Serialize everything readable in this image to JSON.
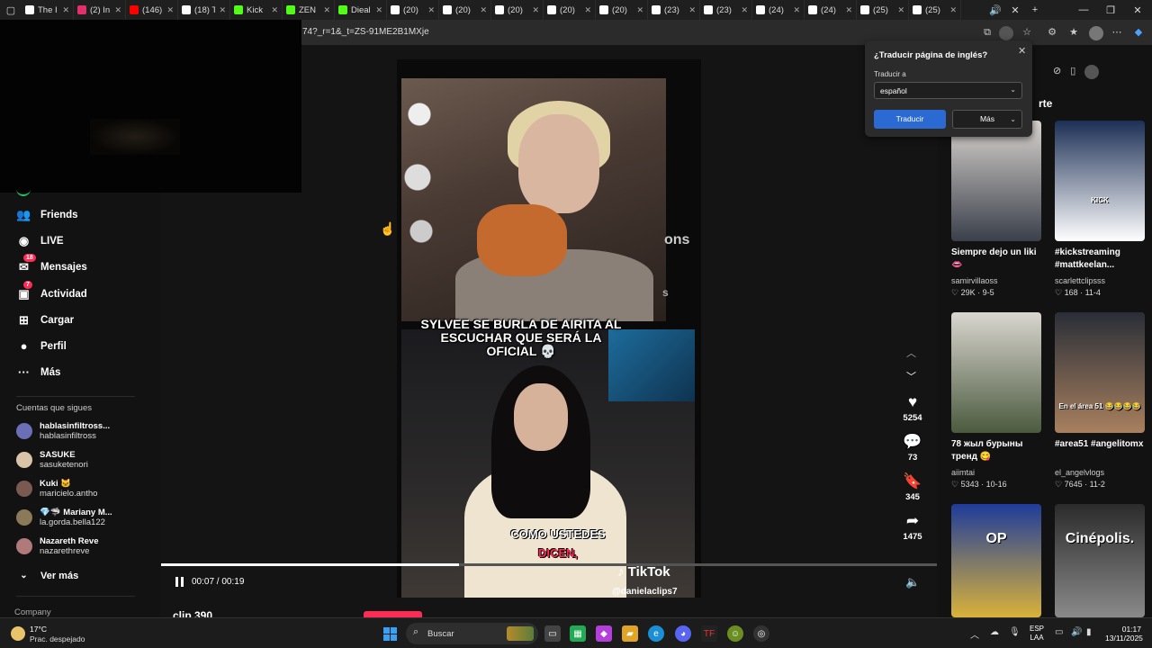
{
  "tabs": [
    {
      "label": "The I",
      "color": "#ffffff"
    },
    {
      "label": "(2) In",
      "color": "#e1306c"
    },
    {
      "label": "(146)",
      "color": "#ff0000"
    },
    {
      "label": "(18) T",
      "color": "#ffffff"
    },
    {
      "label": "Kick",
      "color": "#53fc18"
    },
    {
      "label": "ZEN",
      "color": "#53fc18"
    },
    {
      "label": "Dieal",
      "color": "#53fc18"
    },
    {
      "label": "(20)",
      "color": "#ffffff"
    },
    {
      "label": "(20)",
      "color": "#ffffff"
    },
    {
      "label": "(20)",
      "color": "#ffffff"
    },
    {
      "label": "(20)",
      "color": "#ffffff"
    },
    {
      "label": "(20)",
      "color": "#ffffff"
    },
    {
      "label": "(23)",
      "color": "#ffffff"
    },
    {
      "label": "(23)",
      "color": "#ffffff"
    },
    {
      "label": "(24)",
      "color": "#ffffff"
    },
    {
      "label": "(24)",
      "color": "#ffffff"
    },
    {
      "label": "(25)",
      "color": "#ffffff"
    },
    {
      "label": "(25)",
      "color": "#ffffff"
    }
  ],
  "address": {
    "url": "74?_r=1&_t=ZS-91ME2B1MXje"
  },
  "sidebar": {
    "items": [
      {
        "label": "Friends",
        "icon": "friends-icon",
        "glyph": "👥"
      },
      {
        "label": "LIVE",
        "icon": "live-icon",
        "glyph": "◉"
      },
      {
        "label": "Mensajes",
        "icon": "messages-icon",
        "glyph": "✉",
        "badge": "18"
      },
      {
        "label": "Actividad",
        "icon": "activity-icon",
        "glyph": "▣",
        "badge": "7"
      },
      {
        "label": "Cargar",
        "icon": "upload-icon",
        "glyph": "⊞"
      },
      {
        "label": "Perfil",
        "icon": "profile-icon",
        "glyph": "●"
      },
      {
        "label": "Más",
        "icon": "more-icon",
        "glyph": "···"
      }
    ],
    "following_title": "Cuentas que sigues",
    "following": [
      {
        "name": "hablasinfiltross...",
        "handle": "hablasinfiltross",
        "color": "#6b6fb5"
      },
      {
        "name": "SASUKE",
        "handle": "sasuketenori",
        "color": "#d9c4a8"
      },
      {
        "name": "Kuki 🐱",
        "handle": "maricielo.antho",
        "color": "#7a5a50"
      },
      {
        "name": "💎🦈 Mariany M...",
        "handle": "la.gorda.bella122",
        "color": "#8a7a5a"
      },
      {
        "name": "Nazareth Reve",
        "handle": "nazarethreve",
        "color": "#b07a7a"
      }
    ],
    "see_more": "Ver más",
    "company": "Company"
  },
  "video": {
    "caption_top": "SYLVEE SE BURLA DE AIRITA AL\nESCUCHAR QUE SERÁ LA\nOFICIAL 💀",
    "caption_bottom_1": "COMO USTEDES",
    "caption_bottom_2": "DICEN,",
    "side_text_1": "ons",
    "side_text_2": "s",
    "watermark": "TikTok",
    "handle": "@danielaclips7",
    "time": "00:07 / 00:19",
    "progress": 0.384,
    "clip_title": "clip 390"
  },
  "actions": [
    {
      "icon": "heart-icon",
      "glyph": "♥",
      "count": "5254"
    },
    {
      "icon": "comment-icon",
      "glyph": "💬",
      "count": "73"
    },
    {
      "icon": "bookmark-icon",
      "glyph": "🔖",
      "count": "345"
    },
    {
      "icon": "share-icon",
      "glyph": "➦",
      "count": "1475"
    }
  ],
  "right_panel": {
    "header": "rte",
    "cards": [
      {
        "title": "Siempre dejo un liki",
        "title2": "👄",
        "user": "samirvillaoss",
        "stats": "♡ 29K · 9-5",
        "colors": [
          "#d9d4cf",
          "#3a3f4a"
        ]
      },
      {
        "title": "#kickstreaming",
        "title2": "#mattkeelan...",
        "user": "scarlettclipsss",
        "stats": "♡ 168 · 11-4",
        "colors": [
          "#1c2f55",
          "#ffffff"
        ],
        "overlay": "KICK"
      },
      {
        "title": "78 жыл бурыны",
        "title2": "тренд 😋",
        "user": "aiimtai",
        "stats": "♡ 5343 · 10-16",
        "colors": [
          "#d9d6cf",
          "#4b5a3f"
        ]
      },
      {
        "title": "#area51 #angelitomx",
        "title2": "",
        "user": "el_angelvlogs",
        "stats": "♡ 7645 · 11-2",
        "colors": [
          "#2a2e38",
          "#a8805e"
        ],
        "overlay": "En el área 51 😂😂😂😂"
      },
      {
        "title": "",
        "title2": "",
        "user": "",
        "stats": "",
        "colors": [
          "#1e3c9a",
          "#d9b23a"
        ],
        "overlay": "OP"
      },
      {
        "title": "",
        "title2": "",
        "user": "",
        "stats": "",
        "colors": [
          "#2b2b2b",
          "#8a8a8a"
        ],
        "overlay": "Cinépolis."
      }
    ]
  },
  "translate": {
    "title": "¿Traducir página de inglés?",
    "label": "Traducir a",
    "language": "español",
    "primary": "Traducir",
    "secondary": "Más"
  },
  "taskbar": {
    "temp": "17°C",
    "weather": "Prac. despejado",
    "search_placeholder": "Buscar",
    "lang_1": "ESP",
    "lang_2": "LAA",
    "time": "01:17",
    "date": "13/11/2025"
  }
}
